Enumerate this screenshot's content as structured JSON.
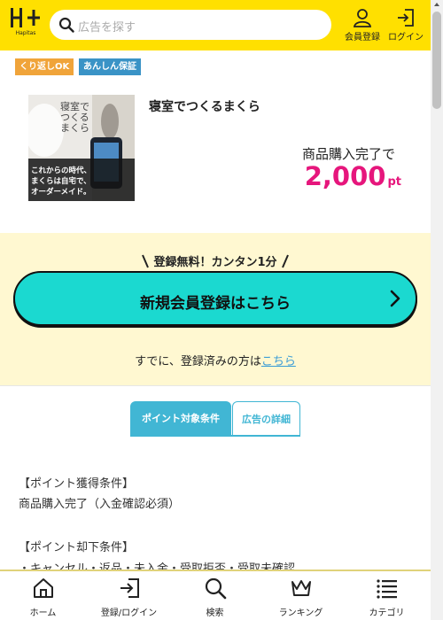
{
  "header": {
    "logo_text": "Hapitas",
    "search_placeholder": "広告を探す",
    "register_label": "会員登録",
    "login_label": "ログイン"
  },
  "tags": [
    "くり返しOK",
    "あんしん保証"
  ],
  "product": {
    "title": "寝室でつくるまくら",
    "image_text": {
      "heading_lines": [
        "寝室で",
        "つくる",
        "まくら"
      ],
      "caption_lines": [
        "これからの時代、",
        "まくらは自宅で、",
        "オーダーメイド。"
      ]
    },
    "reward_condition": "商品購入完了で",
    "reward_value": "2,000",
    "reward_unit": "pt"
  },
  "signup": {
    "free_text": "登録無料！カンタン1分",
    "button_label": "新規会員登録はこちら",
    "already_text": "すでに、登録済みの方は",
    "already_link": "こちら"
  },
  "tabs": [
    {
      "label": "ポイント対象条件",
      "active": true
    },
    {
      "label": "広告の詳細",
      "active": false
    }
  ],
  "conditions": {
    "earn_heading": "【ポイント獲得条件】",
    "earn_text": "商品購入完了（入金確認必須）",
    "reject_heading": "【ポイント却下条件】",
    "reject_text": "・キャンセル・返品・未入金・受取拒否・受取未確認"
  },
  "bottom_nav": [
    {
      "label": "ホーム",
      "icon": "home-icon"
    },
    {
      "label": "登録/ログイン",
      "icon": "login-icon"
    },
    {
      "label": "検索",
      "icon": "search-icon"
    },
    {
      "label": "ランキング",
      "icon": "crown-icon"
    },
    {
      "label": "カテゴリ",
      "icon": "list-icon"
    }
  ],
  "colors": {
    "header": "#ffe000",
    "accent_cyan": "#1bd9d0",
    "tab_blue": "#41b6d4",
    "points_pink": "#e6167c",
    "signup_bg": "#fff8d1"
  }
}
